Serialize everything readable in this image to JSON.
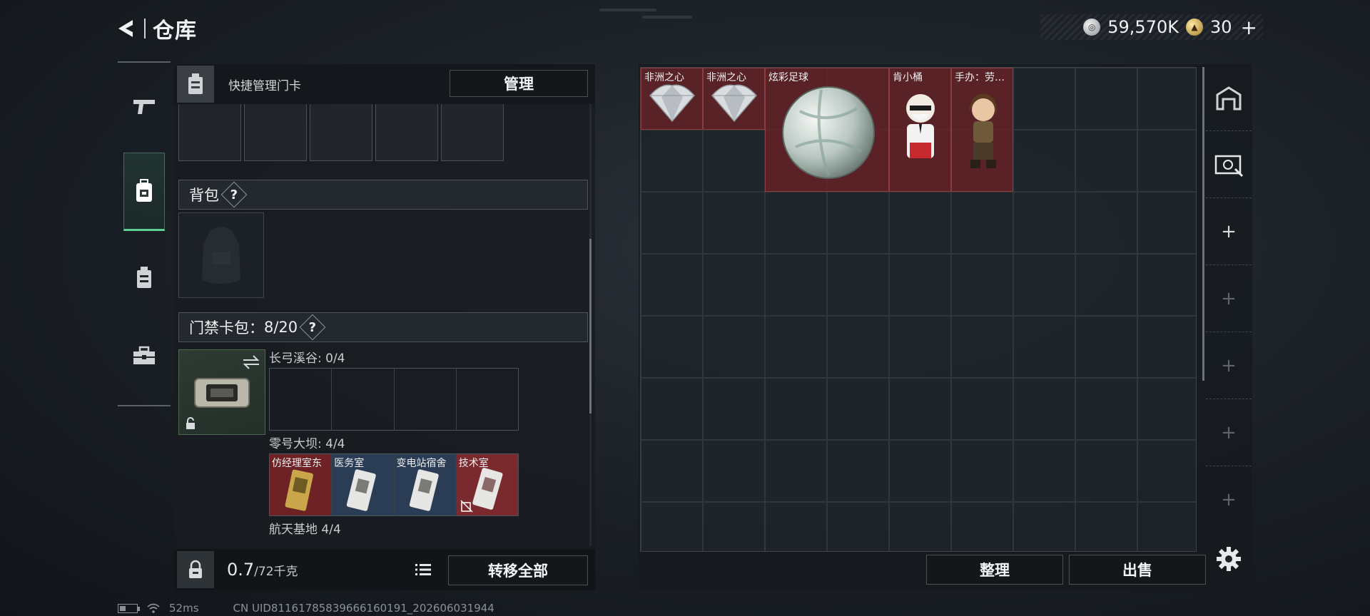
{
  "header": {
    "title": "仓库",
    "silver_amount": "59,570K",
    "gold_amount": "30",
    "plus_label": "+"
  },
  "left_nav": {
    "items": [
      {
        "icon": "pistol-icon",
        "active": false
      },
      {
        "icon": "backpack-icon",
        "active": true
      },
      {
        "icon": "card-case-icon",
        "active": false
      },
      {
        "icon": "toolbox-icon",
        "active": false
      }
    ]
  },
  "quick_manage": {
    "label": "快捷管理门卡",
    "button": "管理"
  },
  "backpack": {
    "label": "背包",
    "help": "?"
  },
  "keycard_case": {
    "label": "门禁卡包",
    "count": "8/20",
    "help": "?",
    "maps": [
      {
        "name": "长弓溪谷",
        "count": "0/4",
        "cards": []
      },
      {
        "name": "零号大坝",
        "count": "4/4",
        "cards": [
          {
            "name": "仿经理室东",
            "color": "gold"
          },
          {
            "name": "医务室",
            "color": "blue"
          },
          {
            "name": "变电站宿舍",
            "color": "blue"
          },
          {
            "name": "技术室",
            "color": "red"
          }
        ]
      },
      {
        "name": "航天基地",
        "count": "4/4"
      }
    ]
  },
  "bottom": {
    "weight": "0.7",
    "weight_max": "/72千克",
    "transfer_all": "转移全部"
  },
  "stash": {
    "items": [
      {
        "name": "非洲之心",
        "kind": "diamond"
      },
      {
        "name": "非洲之心",
        "kind": "diamond"
      },
      {
        "name": "炫彩足球",
        "kind": "ball"
      },
      {
        "name": "肯小桶",
        "kind": "figure-white"
      },
      {
        "name": "手办：劳…",
        "kind": "figure-brown"
      }
    ],
    "tidy": "整理",
    "sell": "出售"
  },
  "right_tools": [
    "warehouse-icon",
    "ticket-icon",
    "+",
    "+",
    "+",
    "+",
    "+"
  ],
  "status": {
    "ping": "52ms",
    "uid": "CN UID8116178583966616019​1_202606031944"
  }
}
